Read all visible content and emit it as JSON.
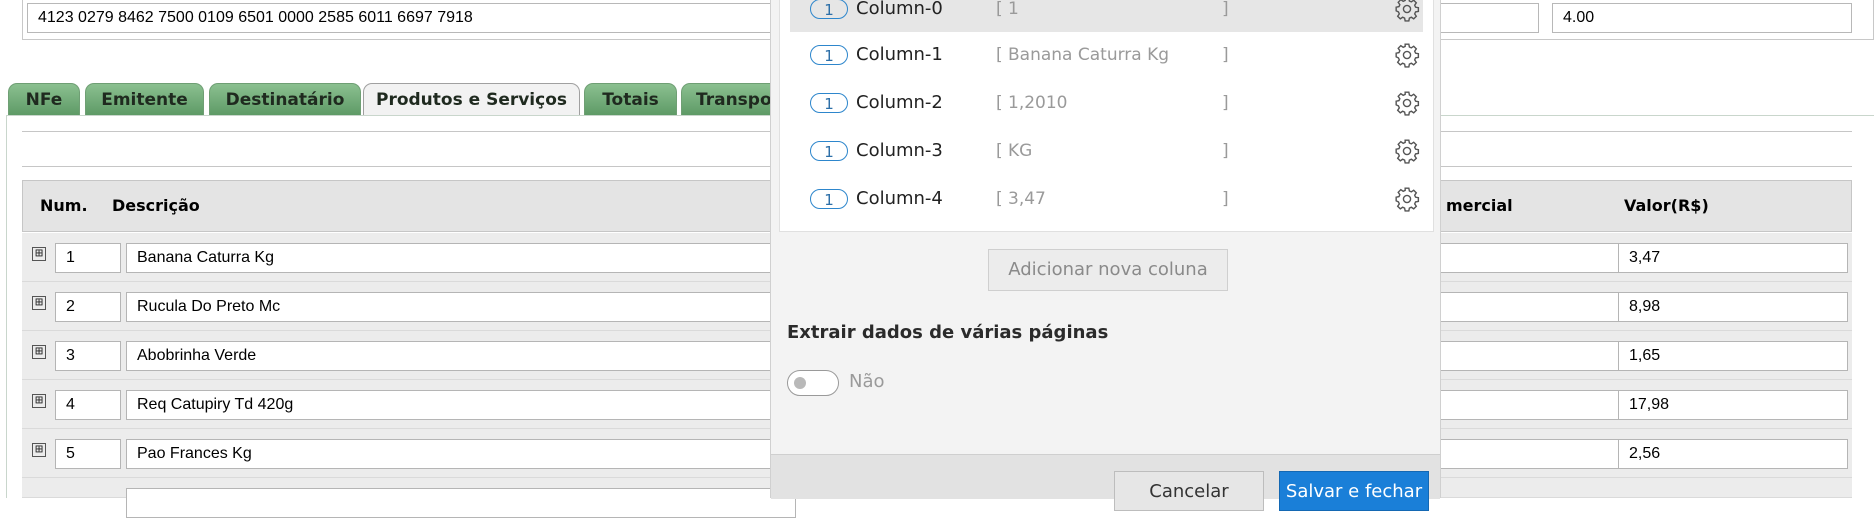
{
  "top_fields": {
    "access_key": "4123 0279 8462 7500 0109 6501 0000 2585 6011 6697 7918",
    "version": "4.00"
  },
  "tabs": [
    {
      "label": "NFe"
    },
    {
      "label": "Emitente"
    },
    {
      "label": "Destinatário"
    },
    {
      "label": "Produtos e Serviços",
      "active": true
    },
    {
      "label": "Totais"
    },
    {
      "label": "Transpo"
    }
  ],
  "grid": {
    "headers": {
      "num": "Num.",
      "descricao": "Descrição",
      "comercial": "mercial",
      "valor": "Valor(R$)"
    },
    "expand_glyph": "⊞",
    "rows": [
      {
        "num": "1",
        "descricao": "Banana Caturra Kg",
        "valor": "3,47"
      },
      {
        "num": "2",
        "descricao": "Rucula Do Preto Mc",
        "valor": "8,98"
      },
      {
        "num": "3",
        "descricao": "Abobrinha Verde",
        "valor": "1,65"
      },
      {
        "num": "4",
        "descricao": "Req Catupiry Td 420g",
        "valor": "17,98"
      },
      {
        "num": "5",
        "descricao": "Pao Frances Kg",
        "valor": "2,56"
      }
    ]
  },
  "modal": {
    "columns": [
      {
        "badge": "1",
        "name": "Column-0",
        "sample": "1",
        "highlighted": true
      },
      {
        "badge": "1",
        "name": "Column-1",
        "sample": "Banana Caturra Kg"
      },
      {
        "badge": "1",
        "name": "Column-2",
        "sample": "1,2010"
      },
      {
        "badge": "1",
        "name": "Column-3",
        "sample": "KG"
      },
      {
        "badge": "1",
        "name": "Column-4",
        "sample": "3,47"
      }
    ],
    "bracket_open": "[",
    "bracket_close": "]",
    "add_column_label": "Adicionar nova coluna",
    "multi_page_title": "Extrair dados de várias páginas",
    "multi_page_toggle_label": "Não",
    "multi_page_toggle_on": false,
    "cancel_label": "Cancelar",
    "save_label": "Salvar e fechar"
  },
  "colors": {
    "tab_green": "#6fae76",
    "primary_button": "#1a7fd8",
    "badge_blue": "#2d86cc"
  }
}
